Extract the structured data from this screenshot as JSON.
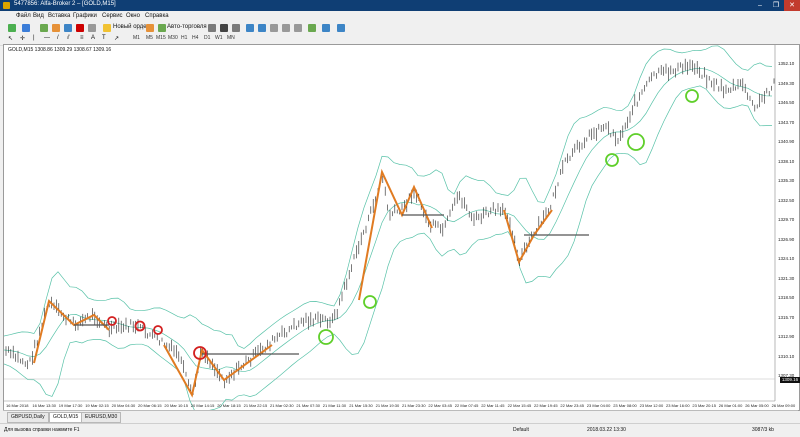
{
  "window": {
    "title": "5477856: Alfa-Broker 2 – [GOLD,M15]",
    "btn_min": "–",
    "btn_max": "❐",
    "btn_close": "✕"
  },
  "menu": [
    "Файл",
    "Вид",
    "Вставка",
    "Графики",
    "Сервис",
    "Окно",
    "Справка"
  ],
  "toolbar": {
    "new_order": "Новый ордер",
    "autotrading": "Авто-торговля"
  },
  "timeframes": [
    "M1",
    "M5",
    "M15",
    "M30",
    "H1",
    "H4",
    "D1",
    "W1",
    "MN"
  ],
  "chart": {
    "info": "GOLD,M15  1308.86 1309.29 1308.67 1309.16",
    "price_labels": [
      "1352.10",
      "1349.30",
      "1346.50",
      "1343.70",
      "1340.90",
      "1338.10",
      "1335.30",
      "1332.50",
      "1329.70",
      "1326.90",
      "1324.10",
      "1321.30",
      "1318.50",
      "1315.70",
      "1312.90",
      "1310.10",
      "1307.30"
    ],
    "time_labels": [
      "16 Mar 2018",
      "16 Mar 13:30",
      "19 Mar 17:30",
      "19 Mar 02:15",
      "20 Mar 04:30",
      "20 Mar 06:15",
      "20 Mar 10:15",
      "20 Mar 14:15",
      "20 Mar 18:15",
      "21 Mar 22:15",
      "21 Mar 02:30",
      "21 Mar 07:30",
      "21 Mar 11:30",
      "21 Mar 15:30",
      "21 Mar 19:30",
      "21 Mar 23:30",
      "22 Mar 03:45",
      "22 Mar 07:45",
      "22 Mar 11:45",
      "22 Mar 15:45",
      "22 Mar 19:45",
      "22 Mar 23:45",
      "23 Mar 04:00",
      "23 Mar 08:00",
      "23 Mar 12:00",
      "23 Mar 16:00",
      "23 Mar 20:15",
      "26 Mar 01:00",
      "26 Mar 05:00",
      "26 Mar 09:00"
    ],
    "current_price": "1309.16"
  },
  "tabs": [
    "GBPUSD,Daily",
    "GOLD,M15",
    "EURUSD,M30"
  ],
  "status": {
    "help": "Для вызова справки нажмите F1",
    "profile": "Default",
    "datetime": "2018.03.22 13:30",
    "traffic": "3087/3 kb"
  }
}
